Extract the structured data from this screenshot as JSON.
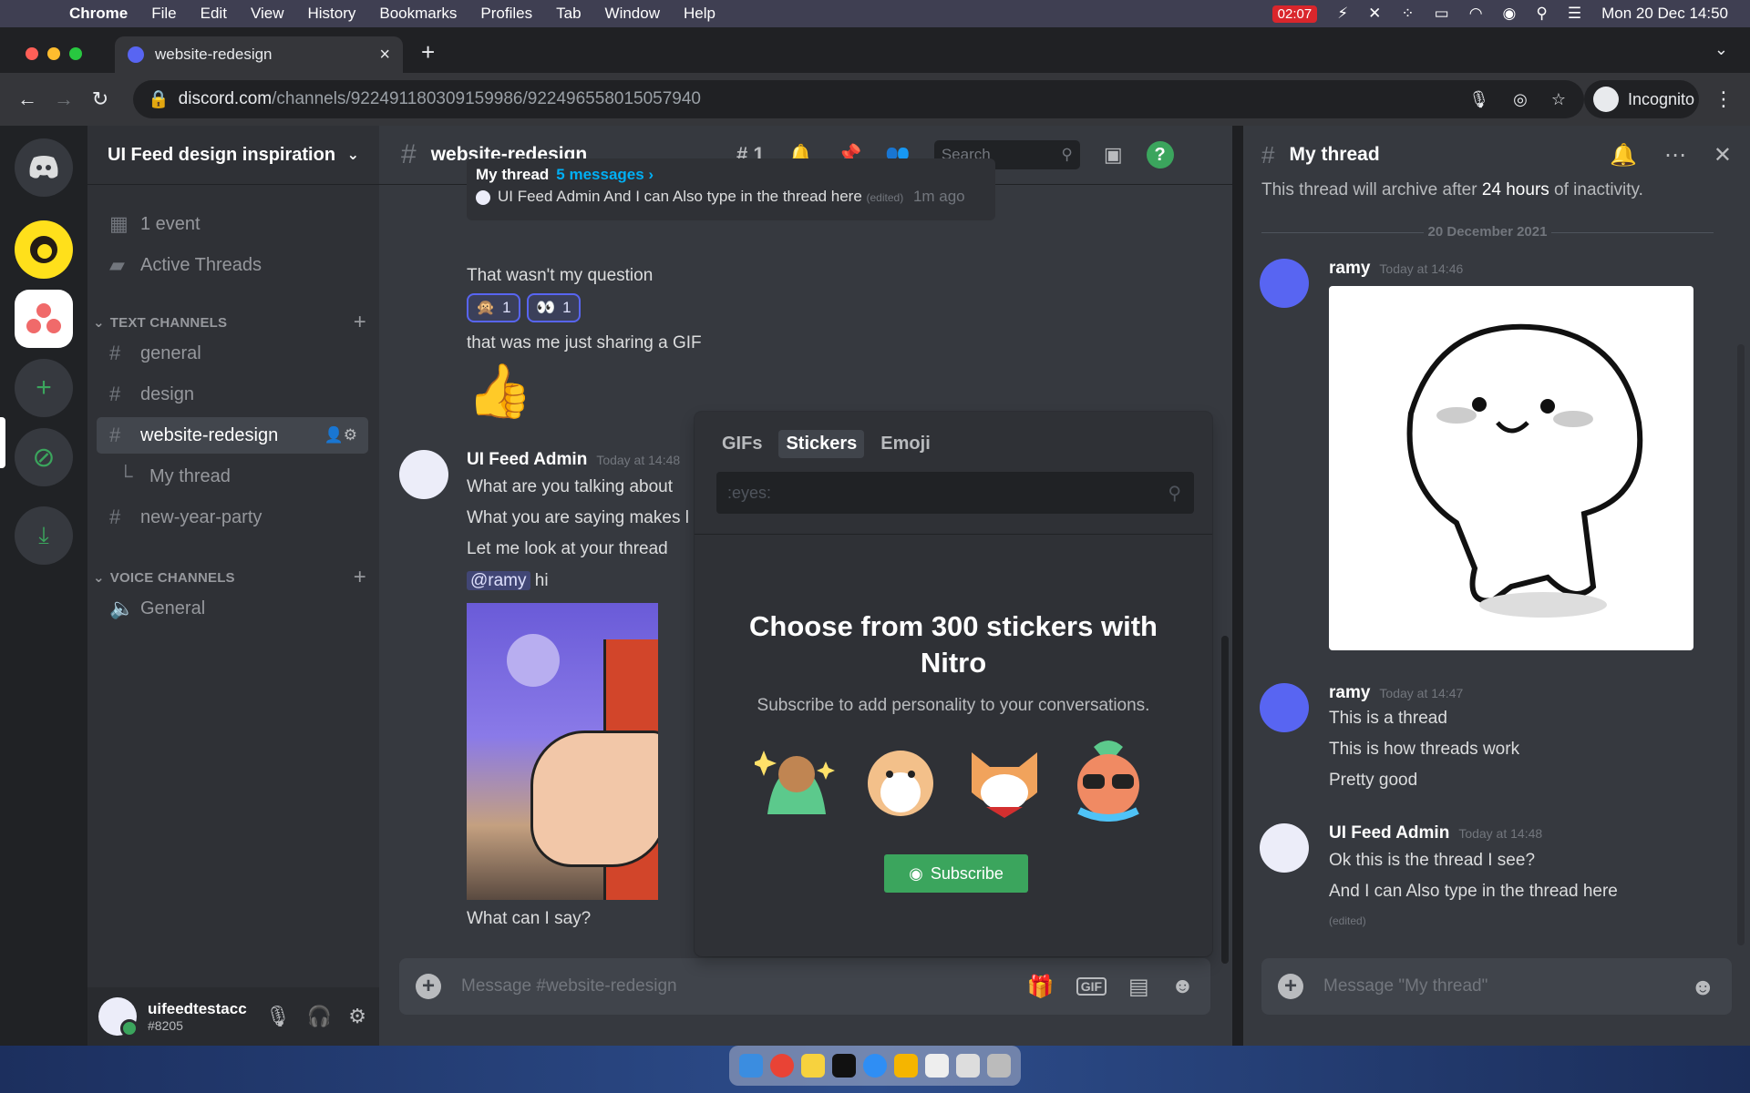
{
  "menubar": {
    "app": "Chrome",
    "items": [
      "File",
      "Edit",
      "View",
      "History",
      "Bookmarks",
      "Profiles",
      "Tab",
      "Window",
      "Help"
    ],
    "battery_time": "02:07",
    "datetime": "Mon 20 Dec  14:50"
  },
  "browser": {
    "tab_title": "website-redesign",
    "url_host": "discord.com",
    "url_path": "/channels/922491180309159986/922496558015057940",
    "profile": "Incognito"
  },
  "server": {
    "name": "UI Feed design inspiration",
    "event": "1 event",
    "active_threads": "Active Threads",
    "text_category": "TEXT CHANNELS",
    "channels": [
      "general",
      "design",
      "website-redesign",
      "My thread",
      "new-year-party"
    ],
    "voice_category": "VOICE CHANNELS",
    "voice_channels": [
      "General"
    ]
  },
  "user": {
    "name": "uifeedtestacc",
    "tag": "#8205"
  },
  "channel": {
    "name": "website-redesign",
    "thread_count": "1",
    "search_placeholder": "Search",
    "composer_placeholder": "Message #website-redesign"
  },
  "messages": {
    "thread_card": {
      "name": "My thread",
      "count": "5 messages ›",
      "preview_author": "UI Feed Admin",
      "preview_text": "And I can Also type in the thread here",
      "edited": "(edited)",
      "time": "1m ago"
    },
    "m1": "That wasn't my question",
    "reactions": [
      {
        "emoji": "🙊",
        "count": "1"
      },
      {
        "emoji": "👀",
        "count": "1"
      }
    ],
    "m2": "that was me just sharing a GIF",
    "thumbs": "👍",
    "author": "UI Feed Admin",
    "author_time": "Today at 14:48",
    "lines": [
      "What are you talking about",
      "What you are saying makes l",
      "Let me look at your thread"
    ],
    "mention": "@ramy",
    "mention_rest": " hi",
    "last": "What can I say?"
  },
  "picker": {
    "tabs": [
      "GIFs",
      "Stickers",
      "Emoji"
    ],
    "search_placeholder": ":eyes:",
    "title": "Choose from 300 stickers with Nitro",
    "subtitle": "Subscribe to add personality to your conversations.",
    "subscribe": "Subscribe"
  },
  "thread": {
    "title": "My thread",
    "info_pre": "This thread will archive after ",
    "info_bold": "24 hours",
    "info_post": " of inactivity.",
    "date": "20 December 2021",
    "msg1": {
      "author": "ramy",
      "time": "Today at 14:46"
    },
    "msg2": {
      "author": "ramy",
      "time": "Today at 14:47",
      "lines": [
        "This is a thread",
        "This is how threads work",
        "Pretty good"
      ]
    },
    "msg3": {
      "author": "UI Feed Admin",
      "time": "Today at 14:48",
      "lines": [
        "Ok this is the thread I see?",
        "And I can Also type in the thread here"
      ],
      "edited": "(edited)"
    },
    "composer_placeholder": "Message \"My thread\""
  },
  "colors": {
    "blurple": "#5865f2",
    "green": "#3ba55d",
    "link": "#00aff4"
  }
}
